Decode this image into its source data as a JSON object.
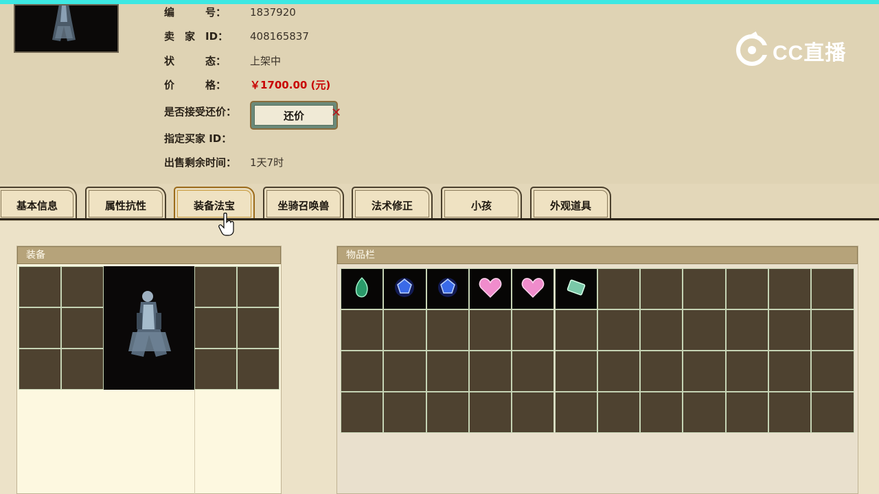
{
  "listing": {
    "fields": [
      {
        "label": "编　　　号：",
        "value": "1837920"
      },
      {
        "label": "卖　家　ID：",
        "value": "408165837"
      },
      {
        "label": "状　　　态：",
        "value": "上架中"
      },
      {
        "label": "价　　　格：",
        "value": "￥1700.00 (元)"
      },
      {
        "label": "是否接受还价：",
        "value": ""
      },
      {
        "label": "指定买家 ID：",
        "value": ""
      },
      {
        "label": "出售剩余时间：",
        "value": "1天7时"
      }
    ],
    "counter_offer_button": "还价"
  },
  "brand": {
    "text": "CC直播"
  },
  "tabs": [
    "基本信息",
    "属性抗性",
    "装备法宝",
    "坐骑召唤兽",
    "法术修正",
    "小孩",
    "外观道具"
  ],
  "active_tab": "装备法宝",
  "equipment_panel": {
    "title": "装备"
  },
  "inventory_panel": {
    "title": "物品栏",
    "items": [
      "green-gem-icon",
      "blue-gem-icon",
      "blue-gem-icon",
      "pink-heart-gem-icon",
      "pink-heart-gem-icon",
      "green-card-icon"
    ]
  },
  "colors": {
    "price": "#c80000",
    "slot": "#4e4230",
    "panel_head": "#b6a37a"
  }
}
